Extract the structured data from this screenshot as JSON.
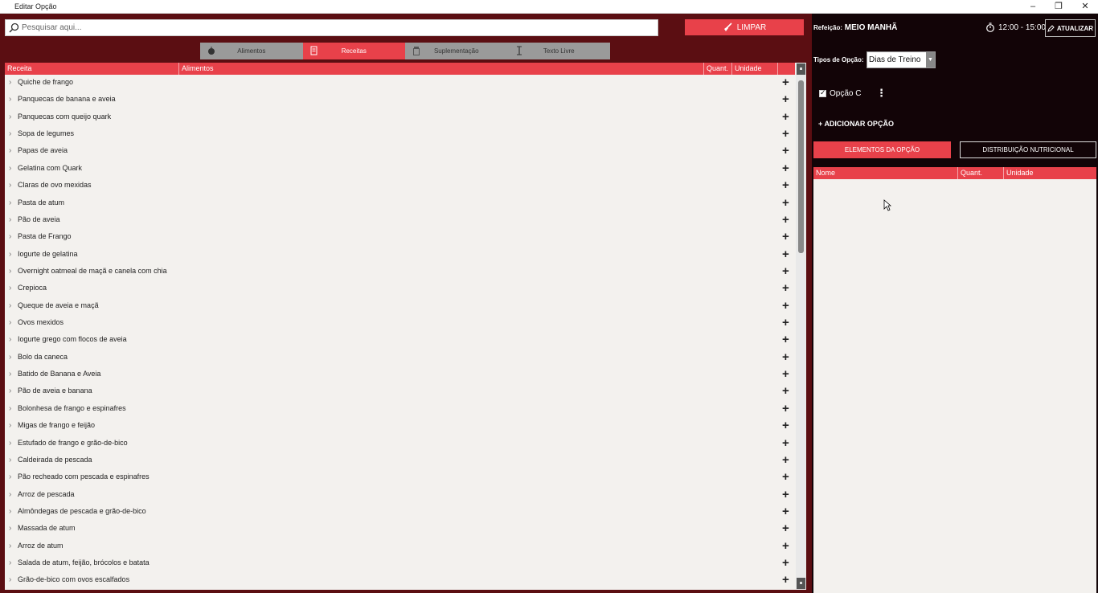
{
  "window": {
    "title": "Editar Opção",
    "controls": [
      "–",
      "❐",
      "✕"
    ]
  },
  "search": {
    "placeholder": "Pesquisar aqui..."
  },
  "limpar_label": "LIMPAR",
  "tabs": [
    {
      "label": "Alimentos",
      "icon": "apple-icon",
      "active": false
    },
    {
      "label": "Receitas",
      "icon": "recipe-icon",
      "active": true
    },
    {
      "label": "Suplementação",
      "icon": "supplement-jar-icon",
      "active": false
    },
    {
      "label": "Texto Livre",
      "icon": "text-cursor-icon",
      "active": false
    }
  ],
  "left_table": {
    "headers": [
      "Receita",
      "Alimentos",
      "Quant.",
      "Unidade"
    ],
    "rows": [
      "Quiche de frango",
      "Panquecas de banana e aveia",
      "Panquecas com queijo quark",
      "Sopa de legumes",
      "Papas de aveia",
      "Gelatina com Quark",
      "Claras de ovo mexidas",
      "Pasta de atum",
      "Pão de aveia",
      "Pasta de Frango",
      "Iogurte de gelatina",
      "Overnight oatmeal de maçã e canela com chia",
      "Crepioca",
      "Queque de aveia e maçã",
      "Ovos mexidos",
      "Iogurte grego com flocos de aveia",
      "Bolo da caneca",
      "Batido de Banana e Aveia",
      "Pão de aveia e banana",
      "Bolonhesa de frango e espinafres",
      "Migas de frango e feijão",
      "Estufado de frango e grão-de-bico",
      "Caldeirada de pescada",
      "Pão recheado com pescada e espinafres",
      "Arroz de pescada",
      "Almôndegas de pescada e grão-de-bico",
      "Massada de atum",
      "Arroz de atum",
      "Salada de atum, feijão, brócolos e batata",
      "Grão-de-bico com ovos escalfados"
    ]
  },
  "right": {
    "refeicao_label": "Refeição:",
    "refeicao_value": "MEIO MANHÃ",
    "time_range": "12:00 - 15:00",
    "atualizar_label": "ATUALIZAR",
    "tipos_label": "Tipos de Opção:",
    "tipos_value": "Dias de Treino",
    "opcao_label": "Opção C",
    "add_opcao_label": "ADICIONAR OPÇÃO",
    "tab_elementos": "ELEMENTOS DA OPÇÃO",
    "tab_distribuicao": "DISTRIBUIÇÃO NUTRICIONAL",
    "headers": [
      "Nome",
      "Quant.",
      "Unidade"
    ]
  },
  "colors": {
    "accent": "#e8414a",
    "left_bg": "#5b0e12",
    "right_bg": "#120407",
    "table_bg": "#f3f1ee"
  }
}
